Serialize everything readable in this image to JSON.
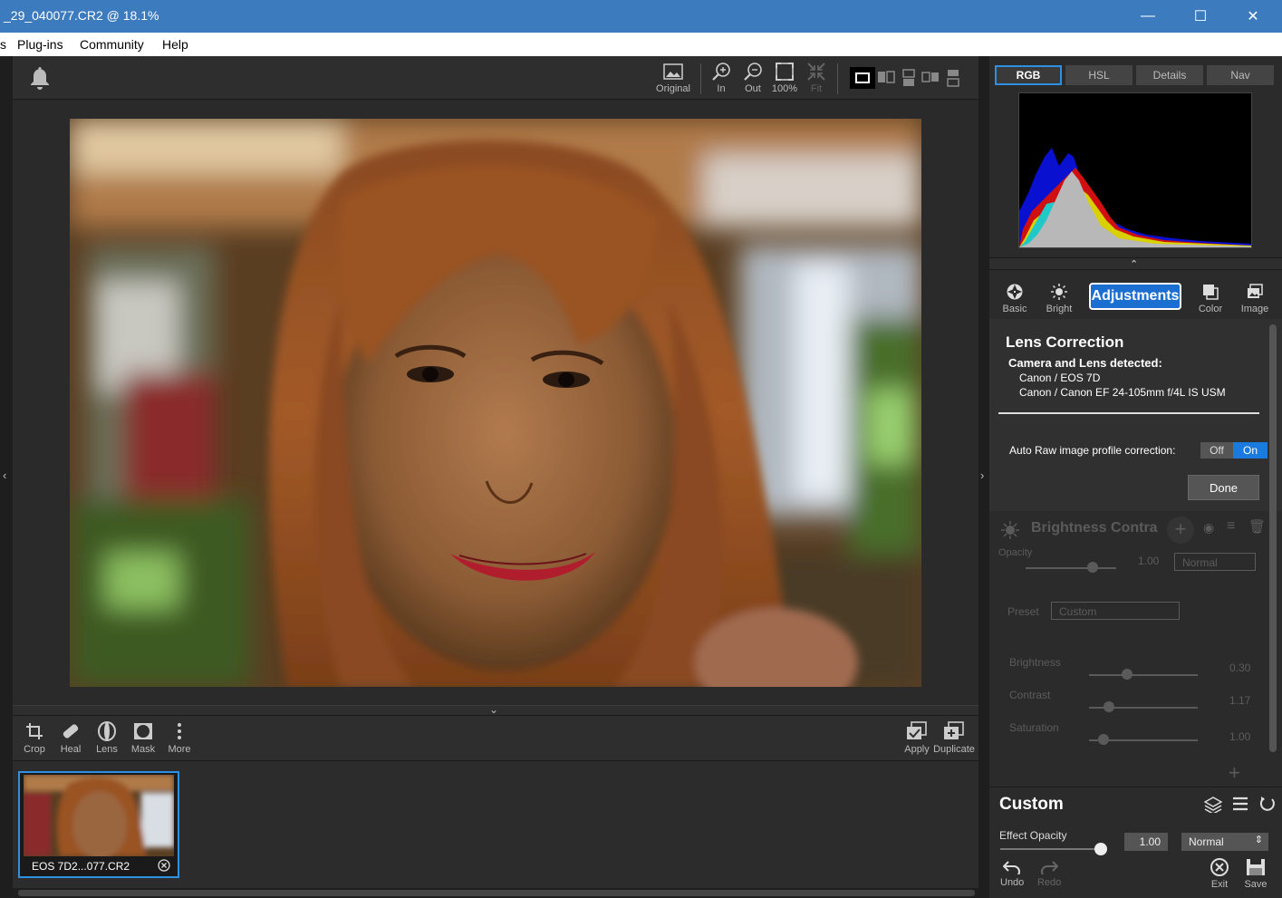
{
  "window": {
    "title": "_29_040077.CR2 @ 18.1%",
    "minimize": "—",
    "maximize": "☐",
    "close": "✕"
  },
  "menu": {
    "items": [
      "s",
      "Plug-ins",
      "Community",
      "Help"
    ]
  },
  "top_toolbar": {
    "original": "Original",
    "zoom_in": "In",
    "zoom_out": "Out",
    "zoom_100": "100%",
    "fit": "Fit"
  },
  "edit_toolbar": {
    "crop": "Crop",
    "heal": "Heal",
    "lens": "Lens",
    "mask": "Mask",
    "more": "More",
    "apply": "Apply",
    "duplicate": "Duplicate"
  },
  "filmstrip": {
    "thumb_label": "EOS 7D2...077.CR2"
  },
  "histogram_tabs": [
    "RGB",
    "HSL",
    "Details",
    "Nav"
  ],
  "module_tabs": {
    "basic": "Basic",
    "bright": "Bright",
    "adjustments": "Adjustments",
    "color": "Color",
    "image": "Image"
  },
  "lens_correction": {
    "title": "Lens Correction",
    "detected_label": "Camera and Lens detected:",
    "camera": "Canon / EOS 7D",
    "lens": "Canon / Canon EF 24-105mm f/4L IS USM",
    "auto_label": "Auto Raw image profile correction:",
    "off": "Off",
    "on": "On",
    "done": "Done"
  },
  "brightness_contrast": {
    "title": "Brightness Contra",
    "opacity_label": "Opacity",
    "opacity_value": "1.00",
    "blend": "Normal",
    "preset_label": "Preset",
    "preset_value": "Custom",
    "brightness_label": "Brightness",
    "brightness_value": "0.30",
    "contrast_label": "Contrast",
    "contrast_value": "1.17",
    "saturation_label": "Saturation",
    "saturation_value": "1.00"
  },
  "custom": {
    "title": "Custom",
    "effect_opacity_label": "Effect Opacity",
    "effect_opacity_value": "1.00",
    "blend": "Normal",
    "undo": "Undo",
    "redo": "Redo",
    "exit": "Exit",
    "save": "Save"
  },
  "colors": {
    "accent": "#2f8fe0",
    "titlebar": "#3c7bbd"
  }
}
